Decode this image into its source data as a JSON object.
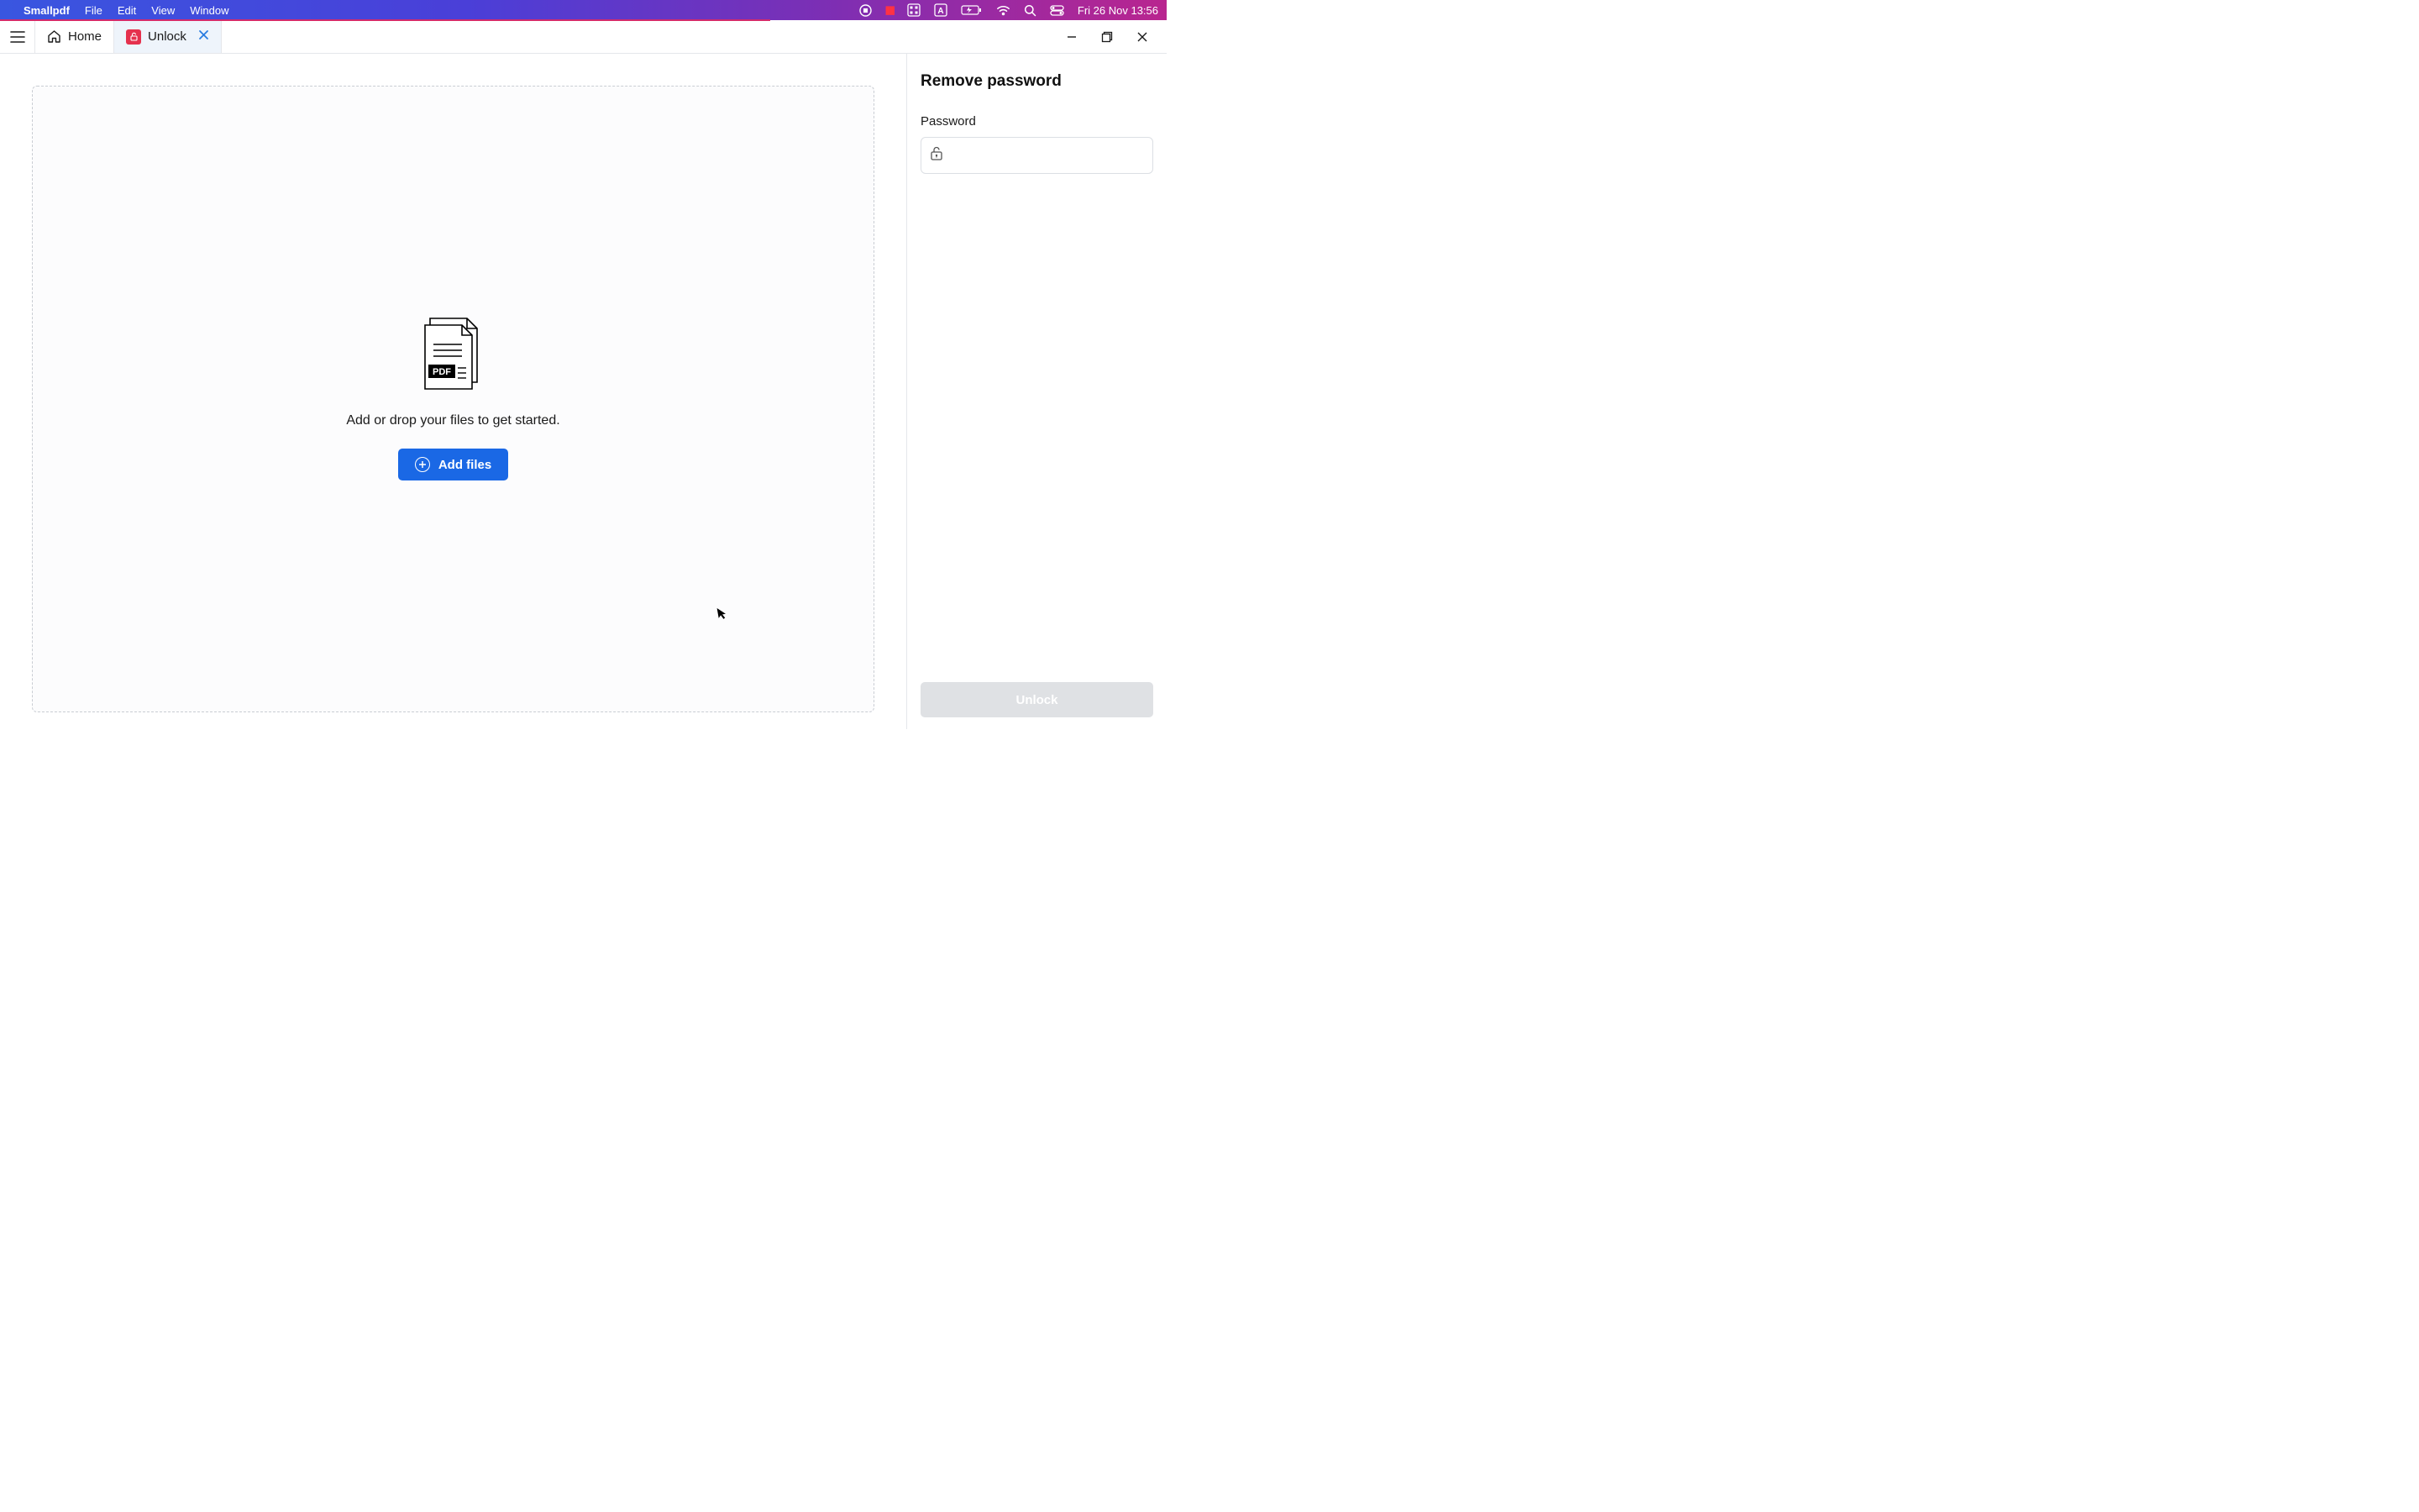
{
  "menubar": {
    "app_name": "Smallpdf",
    "items": [
      "File",
      "Edit",
      "View",
      "Window"
    ],
    "datetime": "Fri 26 Nov  13:56"
  },
  "tabs": {
    "home": "Home",
    "unlock": "Unlock"
  },
  "dropzone": {
    "prompt": "Add or drop your files to get started.",
    "add_files": "Add files",
    "pdf_badge": "PDF"
  },
  "sidebar": {
    "title": "Remove password",
    "password_label": "Password",
    "password_value": "",
    "unlock_button": "Unlock"
  }
}
